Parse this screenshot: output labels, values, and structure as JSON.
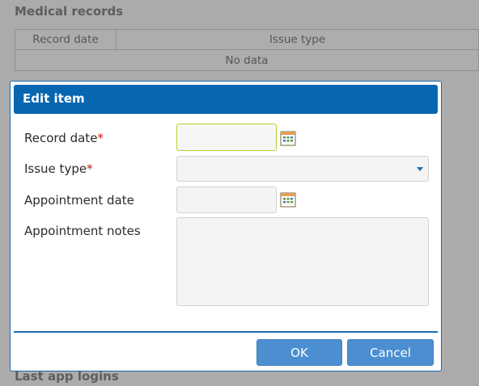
{
  "background": {
    "section_title": "Medical records",
    "grid": {
      "columns": [
        "Record date",
        "Issue type"
      ],
      "empty_text": "No data"
    },
    "bottom_section_title": "Last app logins"
  },
  "dialog": {
    "title": "Edit item",
    "fields": {
      "record_date": {
        "label": "Record date",
        "required_mark": "*",
        "value": ""
      },
      "issue_type": {
        "label": "Issue type",
        "required_mark": "*",
        "value": ""
      },
      "appointment_date": {
        "label": "Appointment date",
        "value": ""
      },
      "appointment_notes": {
        "label": "Appointment notes",
        "value": ""
      }
    },
    "buttons": {
      "ok": "OK",
      "cancel": "Cancel"
    }
  },
  "icons": [
    "calendar-icon",
    "chevron-down-icon"
  ],
  "colors": {
    "header": "#0866b0",
    "button": "#4c8fd0",
    "required": "#d01010",
    "focus_border": "#b5d12b"
  }
}
